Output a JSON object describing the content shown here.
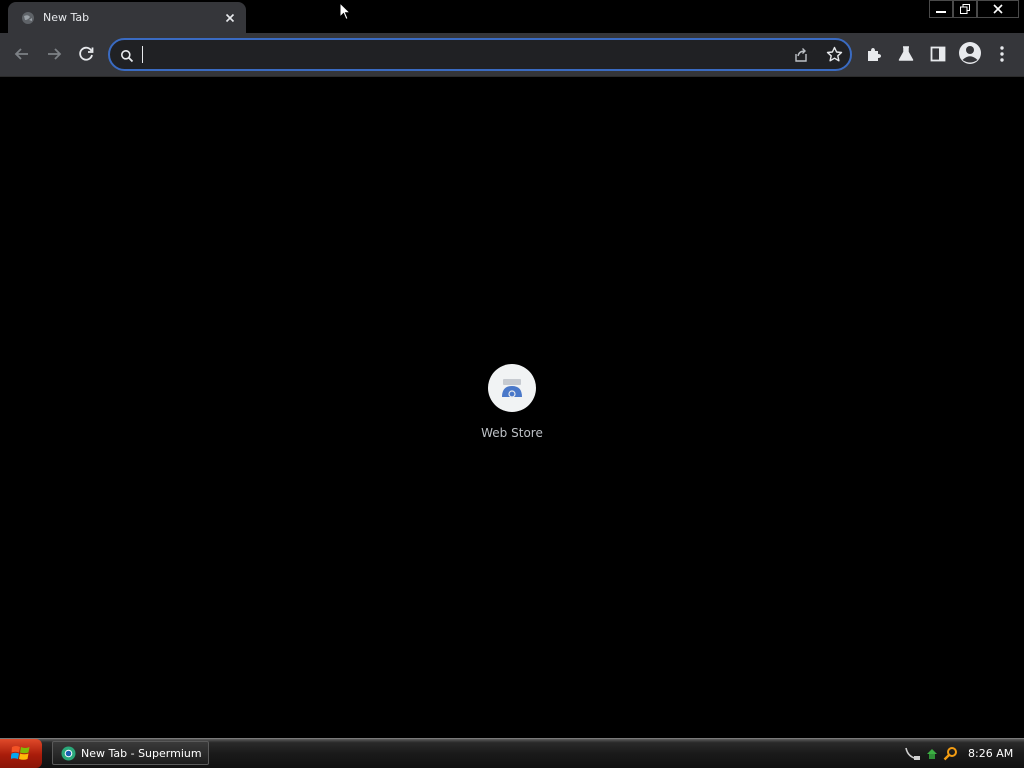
{
  "tab": {
    "title": "New Tab",
    "favicon": "globe-icon",
    "close_icon": "close-icon"
  },
  "window_controls": {
    "minimize_icon": "minimize-icon",
    "maximize_icon": "restore-icon",
    "close_icon": "close-icon"
  },
  "toolbar": {
    "back_icon": "arrow-left-icon",
    "forward_icon": "arrow-right-icon",
    "reload_icon": "reload-icon",
    "extensions_icon": "puzzle-icon",
    "labs_icon": "flask-icon",
    "side_panel_icon": "side-panel-icon",
    "profile_icon": "avatar-icon",
    "menu_icon": "kebab-menu-icon"
  },
  "omnibox": {
    "value": "",
    "search_icon": "search-icon",
    "share_icon": "share-icon",
    "bookmark_icon": "star-icon"
  },
  "shortcuts": [
    {
      "label": "Web Store",
      "icon": "web-store-icon"
    }
  ],
  "taskbar": {
    "start_icon": "windows-logo-icon",
    "items": [
      {
        "label": "New Tab - Supermium",
        "icon": "supermium-icon"
      }
    ],
    "clock": "8:26 AM"
  },
  "colors": {
    "accent": "#3a6bc2",
    "toolbar": "#35363a",
    "omnibox": "#202124",
    "background": "#000000",
    "start": "#c0301a"
  }
}
